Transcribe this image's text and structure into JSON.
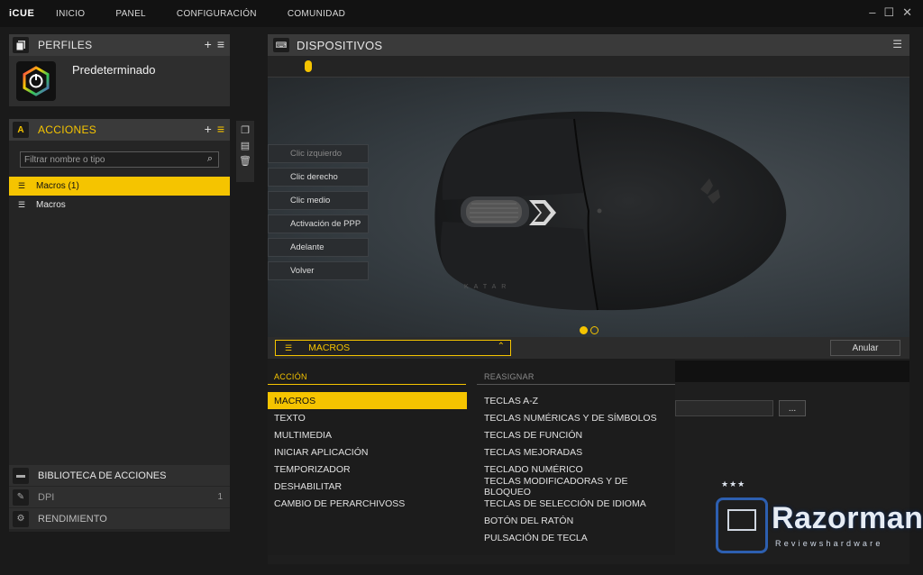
{
  "topbar": {
    "brand": "iCUE",
    "nav": [
      "INICIO",
      "PANEL",
      "CONFIGURACIÓN",
      "COMUNIDAD"
    ],
    "window_controls": [
      "minimize-icon",
      "maximize-icon",
      "close-icon"
    ]
  },
  "perfiles": {
    "title": "PERFILES",
    "add_icon": "+",
    "menu_icon": "≡",
    "profile_name": "Predeterminado"
  },
  "acciones": {
    "title": "ACCIONES",
    "badge_letter": "A",
    "add_icon": "+",
    "menu_icon": "≡",
    "filter_placeholder": "Filtrar nombre o tipo",
    "items": [
      {
        "label": "Macros (1)",
        "selected": true
      },
      {
        "label": "Macros",
        "selected": false
      }
    ]
  },
  "bottom_sections": [
    {
      "label": "BIBLIOTECA DE ACCIONES",
      "count": ""
    },
    {
      "label": "DPI",
      "count": "1"
    },
    {
      "label": "RENDIMIENTO",
      "count": ""
    }
  ],
  "devices": {
    "title": "DISPOSITIVOS",
    "buttons": [
      "Clic izquierdo",
      "Clic derecho",
      "Clic medio",
      "Activación de PPP",
      "Adelante",
      "Volver"
    ],
    "mouse_text": "KATAR"
  },
  "action_bar": {
    "selected": "MACROS",
    "cancel_label": "Anular",
    "browse_label": "..."
  },
  "dropdown": {
    "accion_header": "ACCIÓN",
    "reasignar_header": "REASIGNAR",
    "accion_options": [
      "MACROS",
      "TEXTO",
      "MULTIMEDIA",
      "INICIAR APLICACIÓN",
      "TEMPORIZADOR",
      "DESHABILITAR",
      "CAMBIO DE PERARCHIVOSS"
    ],
    "reasignar_options": [
      "TECLAS A-Z",
      "TECLAS NUMÉRICAS Y DE SÍMBOLOS",
      "TECLAS DE FUNCIÓN",
      "TECLAS MEJORADAS",
      "TECLADO NUMÉRICO",
      "TECLAS MODIFICADORAS Y DE BLOQUEO",
      "TECLAS DE SELECCIÓN DE IDIOMA",
      "BOTÓN DEL RATÓN",
      "PULSACIÓN DE TECLA"
    ]
  },
  "watermark": {
    "stars": "★★★",
    "name": "Razorman",
    "tagline": "Reviewshardware"
  },
  "colors": {
    "accent": "#f5c400",
    "background": "#1a1a1a",
    "panel": "#3a3a3a"
  }
}
